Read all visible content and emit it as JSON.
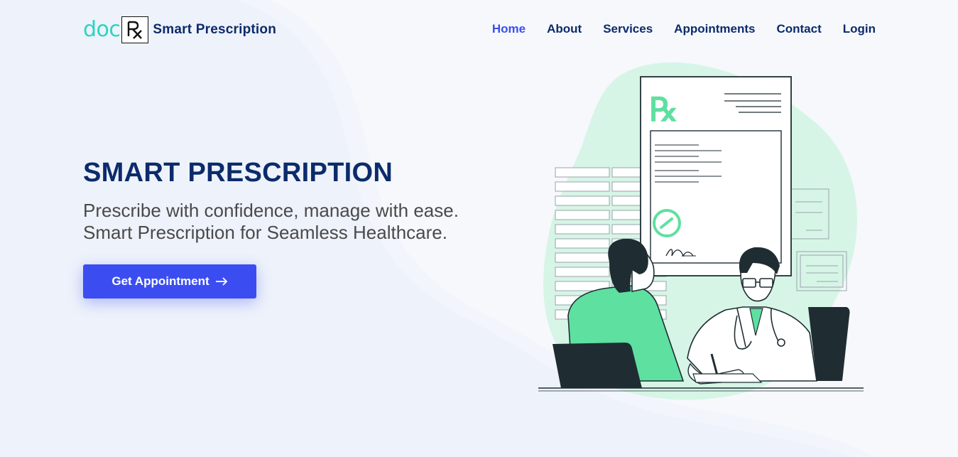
{
  "logo": {
    "prefix": "doc",
    "badge": "Rx",
    "text": "Smart Prescription"
  },
  "nav": {
    "items": [
      {
        "label": "Home",
        "active": true
      },
      {
        "label": "About",
        "active": false
      },
      {
        "label": "Services",
        "active": false
      },
      {
        "label": "Appointments",
        "active": false
      },
      {
        "label": "Contact",
        "active": false
      },
      {
        "label": "Login",
        "active": false
      }
    ]
  },
  "hero": {
    "title": "SMART PRESCRIPTION",
    "subtitle_line1": "Prescribe with confidence, manage with ease.",
    "subtitle_line2": "Smart Prescription for Seamless Healthcare.",
    "cta_label": "Get Appointment"
  },
  "icons": {
    "cta_arrow": "arrow-right-icon",
    "illustration": "doctor-patient-illustration"
  },
  "colors": {
    "brand_navy": "#0b2b6b",
    "accent_blue": "#3b4df1",
    "logo_teal": "#2dd4bf",
    "illustration_green": "#5ee0a0",
    "background": "#eef2fb"
  }
}
